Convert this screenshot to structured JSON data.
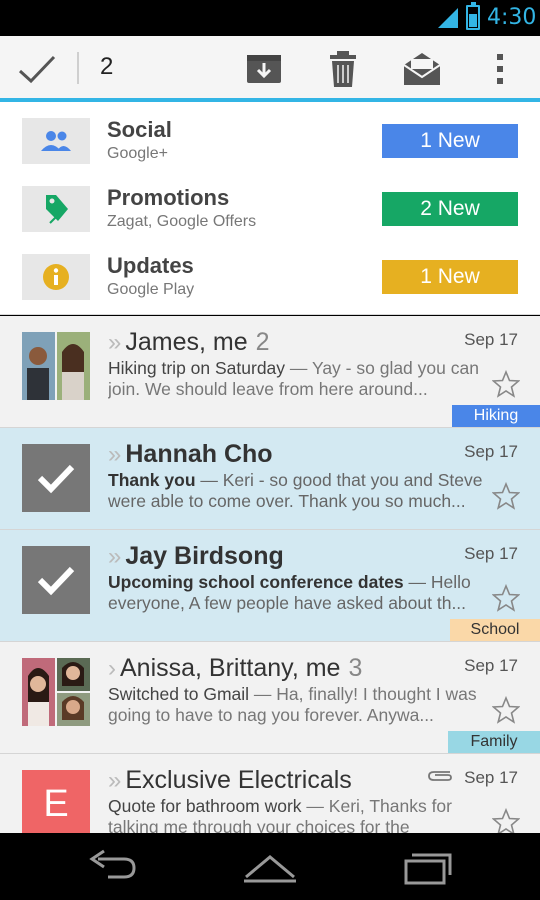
{
  "status_bar": {
    "time": "4:30",
    "icons": [
      "wifi-icon",
      "signal-icon",
      "battery-icon"
    ]
  },
  "action_bar": {
    "selected_count": "2",
    "icons": [
      "done-check-icon",
      "archive-icon",
      "delete-icon",
      "mark-unread-icon",
      "overflow-menu-icon"
    ]
  },
  "categories": [
    {
      "title": "Social",
      "subtitle": "Google+",
      "badge": "1 New",
      "color": "#4a86e8",
      "icon": "social-people-icon"
    },
    {
      "title": "Promotions",
      "subtitle": "Zagat, Google Offers",
      "badge": "2 New",
      "color": "#16a765",
      "icon": "promotions-tag-icon"
    },
    {
      "title": "Updates",
      "subtitle": "Google Play",
      "badge": "1 New",
      "color": "#e6b021",
      "icon": "updates-info-icon"
    }
  ],
  "mails": [
    {
      "sender": "James, me",
      "count": "2",
      "date": "Sep 17",
      "subject": "Hiking trip on Saturday",
      "snippet": " — Yay - so glad you can join. We should leave from here around...",
      "label": "Hiking",
      "label_color": "#4a86e8"
    },
    {
      "sender": "Hannah Cho",
      "date": "Sep 17",
      "subject": "Thank you",
      "snippet": " — Keri - so good that you and Steve were able to come over. Thank you so much..."
    },
    {
      "sender": "Jay Birdsong",
      "date": "Sep 17",
      "subject": "Upcoming school conference dates",
      "snippet": " — Hello everyone, A few people have asked about th...",
      "label": "School",
      "label_color": "#fad8a8"
    },
    {
      "sender": "Anissa, Brittany, me",
      "count": "3",
      "date": "Sep 17",
      "subject": "Switched to Gmail",
      "snippet": " — Ha, finally! I thought I was going to have to nag you forever. Anywa...",
      "label": "Family",
      "label_color": "#98d7e4"
    },
    {
      "sender": "Exclusive Electricals",
      "date": "Sep 17",
      "avatar_letter": "E",
      "subject": "Quote for bathroom work",
      "snippet": " — Keri, Thanks for talking me through your choices for the"
    }
  ],
  "nav_bar": {
    "icons": [
      "back-icon",
      "home-icon",
      "recent-apps-icon"
    ]
  },
  "colors": {
    "accent": "#33b5e5",
    "selected_row": "#d3e9f2"
  }
}
